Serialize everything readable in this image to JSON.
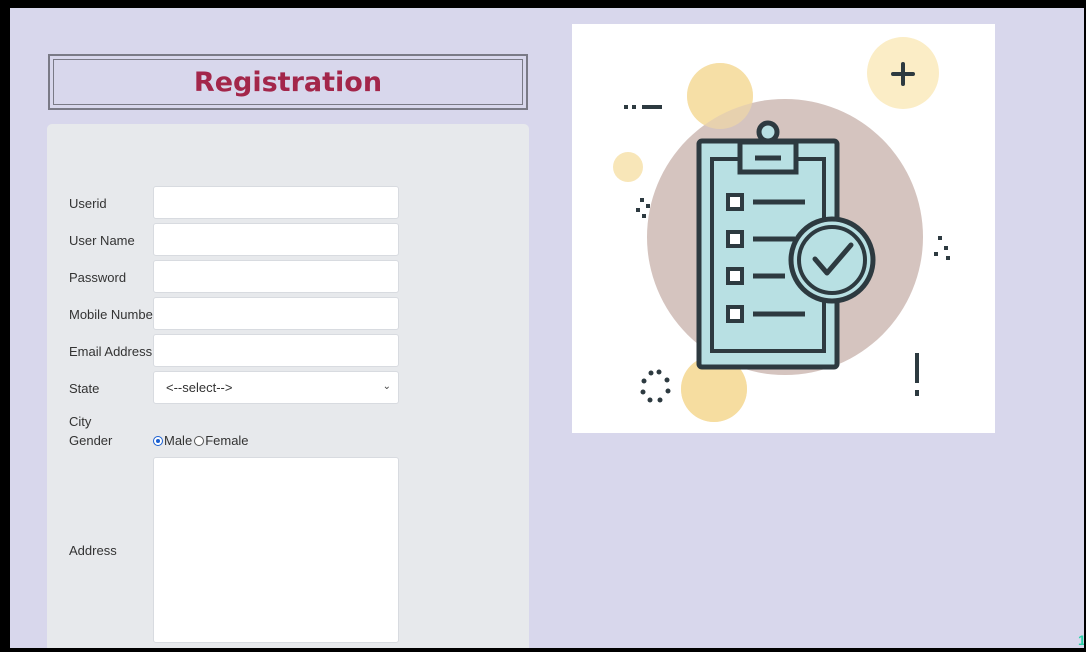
{
  "form": {
    "title": "Registration",
    "fields": [
      {
        "label": "Userid",
        "value": ""
      },
      {
        "label": "User Name",
        "value": ""
      },
      {
        "label": "Password",
        "value": ""
      },
      {
        "label": "Mobile Number",
        "value": ""
      },
      {
        "label": "Email Address",
        "value": ""
      }
    ],
    "state": {
      "label": "State",
      "selected": "<--select-->"
    },
    "city": {
      "label": "City"
    },
    "gender": {
      "label": "Gender",
      "options": [
        "Male",
        "Female"
      ],
      "selected": "Male"
    },
    "address": {
      "label": "Address",
      "value": ""
    }
  },
  "illustration": {
    "subject": "clipboard-checklist-icon",
    "colors": {
      "circle": "#d5c4bf",
      "clipboard": "#b8e0e3",
      "blob": "#f6dda0",
      "outline": "#2d3a40"
    }
  },
  "colors": {
    "title": "#a3264a",
    "page_bg": "#d8d7ec",
    "card_bg": "#e7e9ec",
    "accent": "#1a5fd1"
  }
}
